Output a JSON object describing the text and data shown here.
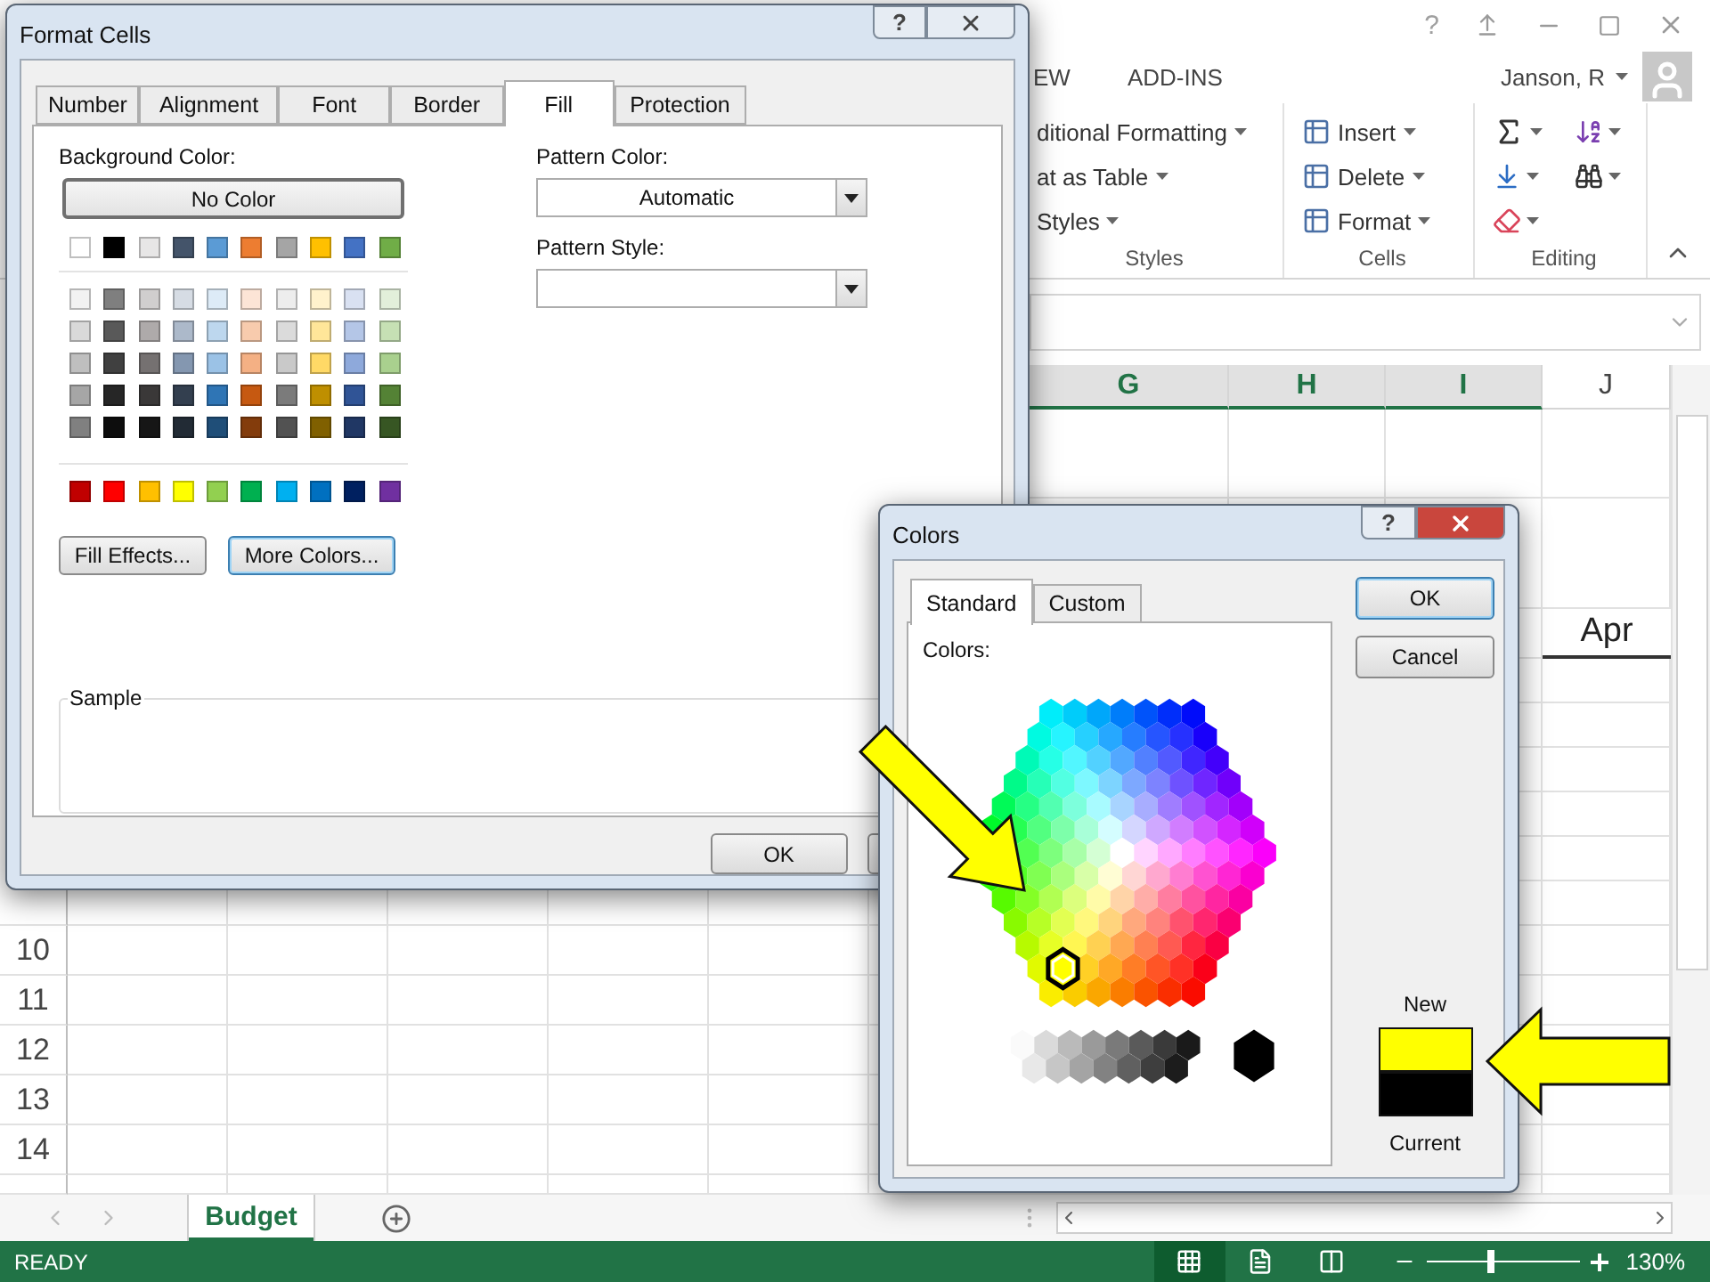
{
  "excel": {
    "help_glyph": "?",
    "ribbon_tabs": [
      "EW",
      "ADD-INS"
    ],
    "user_name": "Janson, R",
    "ribbon_groups": [
      {
        "kind": "styles",
        "label": "Styles",
        "commands": [
          "ditional Formatting",
          "at as Table",
          "Styles"
        ]
      },
      {
        "kind": "cells",
        "label": "Cells",
        "commands": [
          "Insert",
          "Delete",
          "Format"
        ]
      },
      {
        "kind": "editing",
        "label": "Editing"
      }
    ],
    "sheet": {
      "column_headers": [
        {
          "label": "G",
          "selected": true
        },
        {
          "label": "H",
          "selected": true
        },
        {
          "label": "I",
          "selected": true
        },
        {
          "label": "J",
          "selected": false
        }
      ],
      "row_numbers": [
        "10",
        "11",
        "12",
        "13",
        "14"
      ],
      "month_header": "Apr"
    },
    "sheet_tabs": [
      {
        "label": "Budget",
        "selected": true
      }
    ],
    "status_bar": {
      "status": "READY",
      "views": [
        {
          "kind": "normal",
          "selected": true
        },
        {
          "kind": "page_layout",
          "selected": false
        },
        {
          "kind": "page_break",
          "selected": false
        }
      ],
      "zoom_slider": {
        "level": 0.42
      },
      "zoom_text": "130%"
    }
  },
  "format_cells": {
    "title": "Format Cells",
    "help_glyph": "?",
    "tabs": [
      {
        "label": "Number",
        "selected": false
      },
      {
        "label": "Alignment",
        "selected": false
      },
      {
        "label": "Font",
        "selected": false
      },
      {
        "label": "Border",
        "selected": false
      },
      {
        "label": "Fill",
        "selected": true
      },
      {
        "label": "Protection",
        "selected": false
      }
    ],
    "background_color_label": "Background Color:",
    "no_color_button": "No Color",
    "palette": {
      "theme": [
        {
          "color": "#ffffff"
        },
        {
          "color": "#000000"
        },
        {
          "color": "#e7e6e6"
        },
        {
          "color": "#44546a"
        },
        {
          "color": "#5b9bd5"
        },
        {
          "color": "#ed7d31"
        },
        {
          "color": "#a5a5a5"
        },
        {
          "color": "#ffc000"
        },
        {
          "color": "#4472c4"
        },
        {
          "color": "#70ad47"
        }
      ],
      "tints": [
        [
          {
            "color": "#f2f2f2"
          },
          {
            "color": "#7f7f7f"
          },
          {
            "color": "#d0cece"
          },
          {
            "color": "#d6dce4"
          },
          {
            "color": "#ddebf7"
          },
          {
            "color": "#fce4d6"
          },
          {
            "color": "#ededed"
          },
          {
            "color": "#fff2cc"
          },
          {
            "color": "#d9e1f2"
          },
          {
            "color": "#e2efda"
          }
        ],
        [
          {
            "color": "#d9d9d9"
          },
          {
            "color": "#595959"
          },
          {
            "color": "#aeaaaa"
          },
          {
            "color": "#acb9ca"
          },
          {
            "color": "#bdd7ee"
          },
          {
            "color": "#f8cbad"
          },
          {
            "color": "#dbdbdb"
          },
          {
            "color": "#ffe699"
          },
          {
            "color": "#b4c6e7"
          },
          {
            "color": "#c6e0b4"
          }
        ],
        [
          {
            "color": "#bfbfbf"
          },
          {
            "color": "#404040"
          },
          {
            "color": "#757171"
          },
          {
            "color": "#8497b0"
          },
          {
            "color": "#9bc2e6"
          },
          {
            "color": "#f4b084"
          },
          {
            "color": "#c9c9c9"
          },
          {
            "color": "#ffd966"
          },
          {
            "color": "#8ea9db"
          },
          {
            "color": "#a9d08e"
          }
        ],
        [
          {
            "color": "#a6a6a6"
          },
          {
            "color": "#262626"
          },
          {
            "color": "#3a3838"
          },
          {
            "color": "#333f4f"
          },
          {
            "color": "#2f75b5"
          },
          {
            "color": "#c65911"
          },
          {
            "color": "#7b7b7b"
          },
          {
            "color": "#bf8f00"
          },
          {
            "color": "#305496"
          },
          {
            "color": "#548235"
          }
        ],
        [
          {
            "color": "#808080"
          },
          {
            "color": "#0d0d0d"
          },
          {
            "color": "#161616"
          },
          {
            "color": "#222b35"
          },
          {
            "color": "#1f4e78"
          },
          {
            "color": "#833c0c"
          },
          {
            "color": "#525252"
          },
          {
            "color": "#806000"
          },
          {
            "color": "#203764"
          },
          {
            "color": "#375623"
          }
        ]
      ],
      "standard": [
        {
          "color": "#c00000"
        },
        {
          "color": "#ff0000"
        },
        {
          "color": "#ffc000"
        },
        {
          "color": "#ffff00"
        },
        {
          "color": "#92d050"
        },
        {
          "color": "#00b050"
        },
        {
          "color": "#00b0f0"
        },
        {
          "color": "#0070c0"
        },
        {
          "color": "#002060"
        },
        {
          "color": "#7030a0"
        }
      ]
    },
    "pattern_color_label": "Pattern Color:",
    "pattern_color_value": "Automatic",
    "pattern_style_label": "Pattern Style:",
    "buttons": [
      {
        "label": "Fill Effects...",
        "focused": false
      },
      {
        "label": "More Colors...",
        "focused": true
      }
    ],
    "sample_label": "Sample",
    "ok_button": "OK"
  },
  "colors_dialog": {
    "title": "Colors",
    "help_glyph": "?",
    "tabs": [
      {
        "label": "Standard",
        "selected": true
      },
      {
        "label": "Custom",
        "selected": false
      }
    ],
    "colors_label": "Colors:",
    "buttons": [
      {
        "label": "OK",
        "default": true
      },
      {
        "label": "Cancel",
        "default": false
      }
    ],
    "preview": [
      {
        "label": "New",
        "color": "#ffff00"
      },
      {
        "label": "Current",
        "color": "#000000"
      }
    ]
  }
}
